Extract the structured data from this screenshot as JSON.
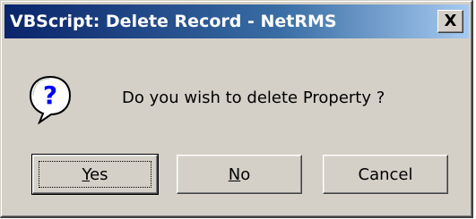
{
  "window": {
    "title": "VBScript: Delete Record - NetRMS",
    "close_glyph": "X"
  },
  "icons": {
    "message_icon": "question-icon",
    "close": "close-icon"
  },
  "message": "Do you wish to delete Property ?",
  "buttons": [
    {
      "label_mnemonic": "Y",
      "label_rest": "es",
      "default": true
    },
    {
      "label_mnemonic": "N",
      "label_rest": "o",
      "default": false
    },
    {
      "label": "Cancel",
      "default": false
    }
  ],
  "colors": {
    "title_start": "#0a246a",
    "title_end": "#a6caf0",
    "face": "#d4d0c8"
  }
}
